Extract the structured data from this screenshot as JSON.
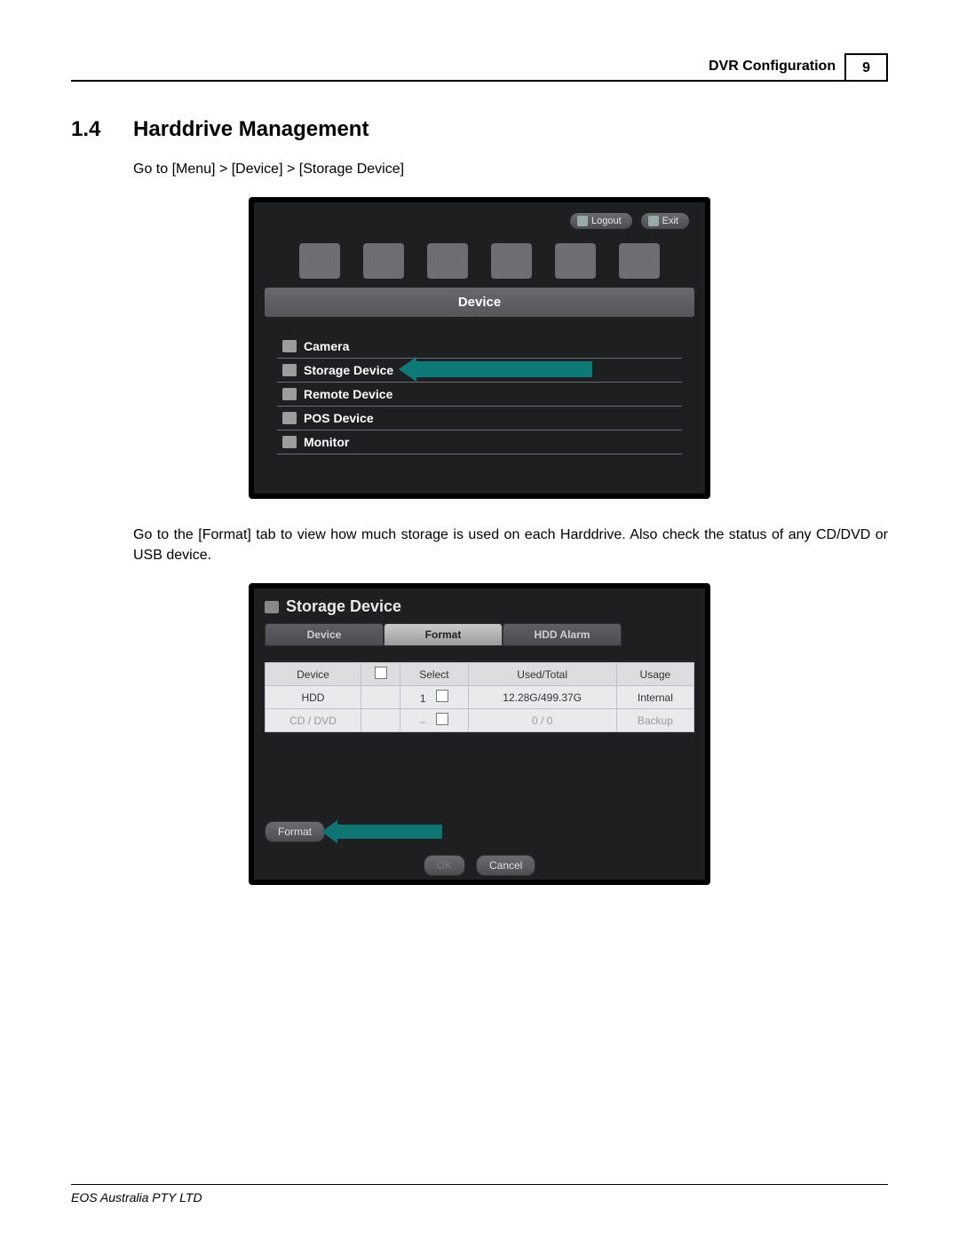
{
  "header": {
    "title": "DVR Configuration",
    "page_number": "9"
  },
  "section": {
    "number": "1.4",
    "title": "Harddrive Management"
  },
  "para1": "Go to [Menu] > [Device] > [Storage Device]",
  "shot1": {
    "logout": "Logout",
    "exit": "Exit",
    "device_header": "Device",
    "menu": {
      "camera": "Camera",
      "storage": "Storage Device",
      "remote": "Remote Device",
      "pos": "POS Device",
      "monitor": "Monitor"
    }
  },
  "para2": "Go to the [Format] tab to view how much storage is used on each Harddrive. Also check the status of any CD/DVD or USB device.",
  "shot2": {
    "title": "Storage Device",
    "tabs": {
      "device": "Device",
      "format": "Format",
      "hdd_alarm": "HDD Alarm"
    },
    "cols": {
      "device": "Device",
      "select": "Select",
      "used_total": "Used/Total",
      "usage": "Usage"
    },
    "rows": [
      {
        "device": "HDD",
        "select": "1",
        "used_total": "12.28G/499.37G",
        "usage": "Internal"
      },
      {
        "device": "CD / DVD",
        "select": "–",
        "used_total": "0 / 0",
        "usage": "Backup"
      }
    ],
    "format_btn": "Format",
    "ok": "OK",
    "cancel": "Cancel"
  },
  "footer": "EOS Australia PTY LTD"
}
